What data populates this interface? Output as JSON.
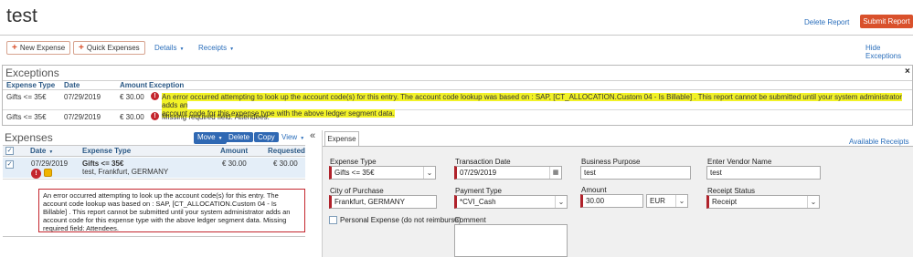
{
  "header": {
    "title": "test",
    "delete_report": "Delete Report",
    "submit_report": "Submit Report",
    "new_expense": "New Expense",
    "quick_expenses": "Quick Expenses",
    "details": "Details",
    "receipts": "Receipts",
    "hide_exceptions": "Hide Exceptions"
  },
  "exceptions": {
    "title": "Exceptions",
    "close": "×",
    "columns": [
      "Expense Type",
      "Date",
      "Amount",
      "Exception"
    ],
    "rows": [
      {
        "type": "Gifts <= 35€",
        "date": "07/29/2019",
        "amount": "€ 30.00",
        "message_line1": "An error occurred attempting to look up the account code(s) for this entry. The account code lookup was based on : SAP, [CT_ALLOCATION.Custom 04 - Is Billable] . This report cannot be submitted until your system administrator adds an",
        "message_line2": "account code for this expense type with the above ledger segment data."
      },
      {
        "type": "Gifts <= 35€",
        "date": "07/29/2019",
        "amount": "€ 30.00",
        "message_line1": "Missing required field: Attendees."
      }
    ]
  },
  "expenses": {
    "title": "Expenses",
    "move": "Move",
    "delete": "Delete",
    "copy": "Copy",
    "view": "View",
    "collapse": "«",
    "columns": {
      "date": "Date",
      "type": "Expense Type",
      "amount": "Amount",
      "requested": "Requested"
    },
    "item": {
      "date": "07/29/2019",
      "type": "Gifts <= 35€",
      "location": "test, Frankfurt, GERMANY",
      "amount": "€ 30.00",
      "requested": "€ 30.00"
    },
    "popup": "An error occurred attempting to look up the account code(s) for this entry. The account code lookup was based on : SAP, [CT_ALLOCATION.Custom 04 - Is Billable] . This report cannot be submitted until your system administrator adds an account code for this expense type with the above ledger segment data. Missing required field: Attendees."
  },
  "form": {
    "tab": "Expense",
    "available_receipts": "Available Receipts",
    "expense_type_label": "Expense Type",
    "expense_type_value": "Gifts <= 35€",
    "transaction_date_label": "Transaction Date",
    "transaction_date_value": "07/29/2019",
    "business_purpose_label": "Business Purpose",
    "business_purpose_value": "test",
    "vendor_label": "Enter Vendor Name",
    "vendor_value": "test",
    "city_label": "City of Purchase",
    "city_value": "Frankfurt, GERMANY",
    "payment_type_label": "Payment Type",
    "payment_type_value": "*CVI_Cash",
    "amount_label": "Amount",
    "amount_value": "30.00",
    "currency_value": "EUR",
    "receipt_status_label": "Receipt Status",
    "receipt_status_value": "Receipt",
    "personal_label": "Personal Expense (do not reimburse)",
    "comment_label": "Comment"
  }
}
